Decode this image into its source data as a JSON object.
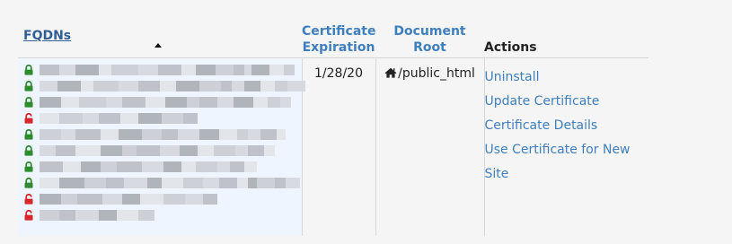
{
  "table": {
    "headers": {
      "fqdns": "FQDNs",
      "expiration_line1": "Certificate",
      "expiration_line2": "Expiration",
      "document_root": "Document Root",
      "actions": "Actions"
    },
    "sort": {
      "column": "FQDNs",
      "direction": "ascending"
    },
    "rows": [
      {
        "fqdns": [
          {
            "lock": "locked",
            "text": ""
          },
          {
            "lock": "locked",
            "text": ""
          },
          {
            "lock": "locked",
            "text": ""
          },
          {
            "lock": "unlocked",
            "text": ""
          },
          {
            "lock": "locked",
            "text": ""
          },
          {
            "lock": "locked",
            "text": ""
          },
          {
            "lock": "locked",
            "text": ""
          },
          {
            "lock": "locked",
            "text": ""
          },
          {
            "lock": "unlocked",
            "text": ""
          },
          {
            "lock": "unlocked",
            "text": ""
          }
        ],
        "expiration": "1/28/20",
        "document_root": "/public_html",
        "actions": [
          "Uninstall",
          "Update Certificate",
          "Certificate Details",
          "Use Certificate for New Site"
        ]
      }
    ]
  },
  "icons": {
    "locked": "lock-icon",
    "unlocked": "unlock-icon",
    "home": "home-icon"
  },
  "colors": {
    "link": "#3f7fbd",
    "locked": "#2e8b2e",
    "unlocked": "#d62828",
    "fqdn_background": "#eef5ff"
  }
}
